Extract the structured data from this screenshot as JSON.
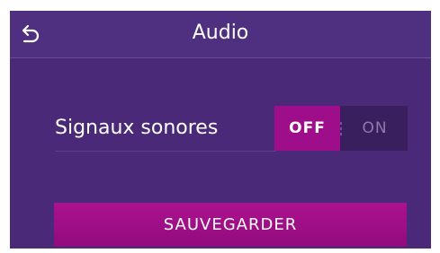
{
  "header": {
    "title": "Audio",
    "back_icon": "back-arrow-icon"
  },
  "settings": {
    "sound_signals": {
      "label": "Signaux sonores",
      "off_label": "OFF",
      "on_label": "ON",
      "selected": "OFF"
    }
  },
  "actions": {
    "save_label": "SAUVEGARDER"
  },
  "colors": {
    "background": "#4a2a78",
    "accent": "#9e0e8a",
    "toggle_track": "#3a1f5f"
  }
}
